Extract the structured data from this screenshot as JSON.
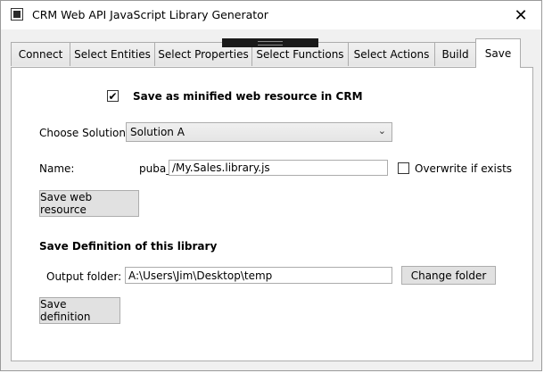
{
  "window": {
    "title": "CRM Web API JavaScript Library Generator",
    "icons": {
      "app": "app-icon",
      "close": "close-icon"
    },
    "close_glyph": "✕"
  },
  "tabs": [
    {
      "label": "Connect",
      "active": false
    },
    {
      "label": "Select Entities",
      "active": false
    },
    {
      "label": "Select Properties",
      "active": false
    },
    {
      "label": "Select Functions",
      "active": false
    },
    {
      "label": "Select Actions",
      "active": false
    },
    {
      "label": "Build",
      "active": false
    },
    {
      "label": "Save",
      "active": true
    }
  ],
  "save": {
    "minified_label": "Save as minified web resource in CRM",
    "minified_checked": true,
    "check_glyph": "✔",
    "solution_label": "Choose Solution:",
    "solution_value": "Solution A",
    "chevron_glyph": "⌄",
    "name_label": "Name:",
    "prefix": "puba_",
    "name_value": "/My.Sales.library.js",
    "overwrite_label": "Overwrite if exists",
    "overwrite_checked": false,
    "save_resource_button": "Save web resource"
  },
  "definition": {
    "heading": "Save Definition of this library",
    "output_label": "Output folder:",
    "output_value": "A:\\Users\\Jim\\Desktop\\temp",
    "change_folder_button": "Change folder",
    "save_definition_button": "Save definition"
  }
}
